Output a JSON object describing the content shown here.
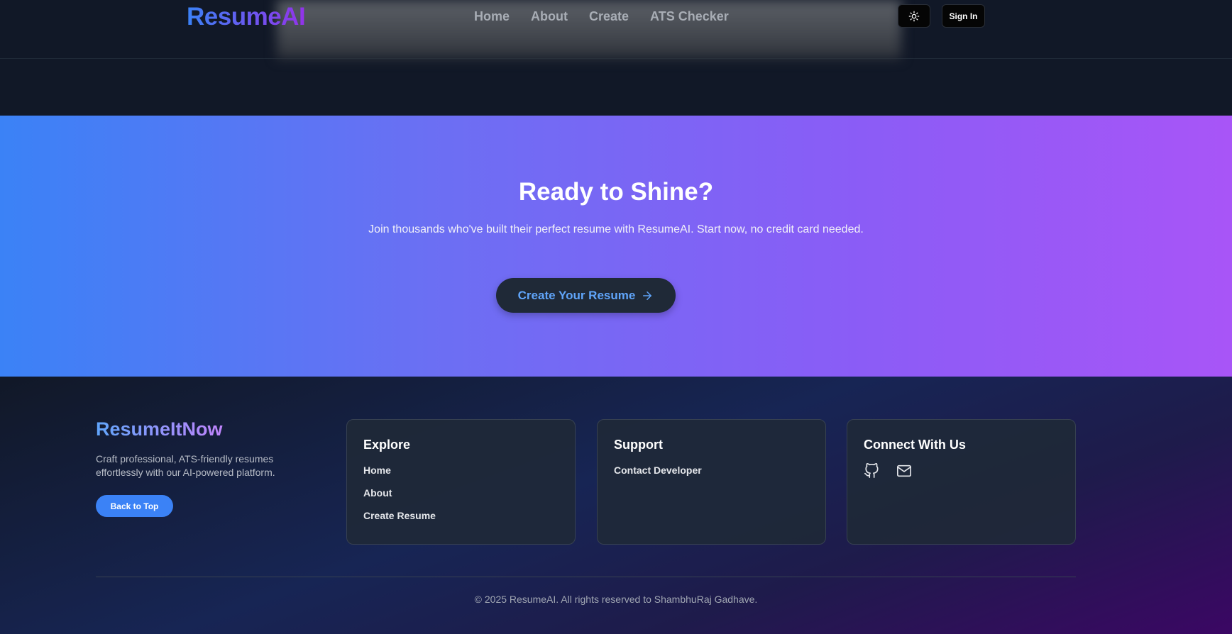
{
  "header": {
    "logo": "ResumeAI",
    "nav": [
      "Home",
      "About",
      "Create",
      "ATS Checker"
    ],
    "theme_icon": "sun-icon",
    "signin_label": "Sign In"
  },
  "cta": {
    "title": "Ready to Shine?",
    "text": "Join thousands who've built their perfect resume with ResumeAI. Start now, no credit card needed.",
    "button_label": "Create Your Resume",
    "button_icon": "arrow-right-icon"
  },
  "footer": {
    "brand": "ResumeItNow",
    "description": "Craft professional, ATS-friendly resumes effortlessly with our AI-powered platform.",
    "back_to_top": "Back to Top",
    "explore": {
      "title": "Explore",
      "links": [
        "Home",
        "About",
        "Create Resume"
      ]
    },
    "support": {
      "title": "Support",
      "links": [
        "Contact Developer"
      ]
    },
    "connect": {
      "title": "Connect With Us",
      "icons": [
        "github-icon",
        "mail-icon"
      ]
    },
    "copyright": "© 2025 ResumeAI. All rights reserved to ShambhuRaj Gadhave."
  },
  "colors": {
    "background": "#111827",
    "accent_blue": "#3b82f6",
    "accent_purple": "#a855f7"
  }
}
